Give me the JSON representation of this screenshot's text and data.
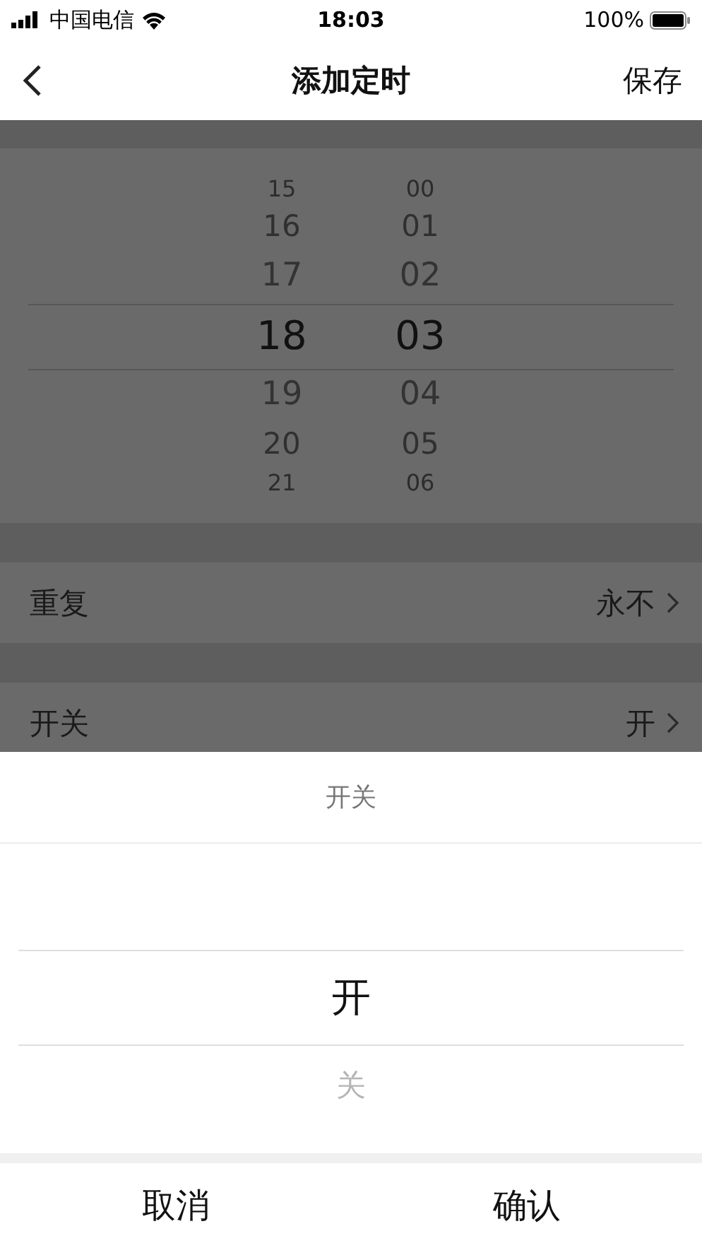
{
  "status_bar": {
    "carrier": "中国电信",
    "time": "18:03",
    "battery": "100%"
  },
  "nav": {
    "title": "添加定时",
    "action": "保存"
  },
  "time_picker": {
    "columns": [
      {
        "items": [
          {
            "label": "15",
            "selected": false
          },
          {
            "label": "16",
            "selected": false
          },
          {
            "label": "17",
            "selected": false
          },
          {
            "label": "18",
            "selected": true
          },
          {
            "label": "19",
            "selected": false
          },
          {
            "label": "20",
            "selected": false
          },
          {
            "label": "21",
            "selected": false
          }
        ]
      },
      {
        "items": [
          {
            "label": "00",
            "selected": false
          },
          {
            "label": "01",
            "selected": false
          },
          {
            "label": "02",
            "selected": false
          },
          {
            "label": "03",
            "selected": true
          },
          {
            "label": "04",
            "selected": false
          },
          {
            "label": "05",
            "selected": false
          },
          {
            "label": "06",
            "selected": false
          }
        ]
      }
    ]
  },
  "settings": [
    {
      "label": "重复",
      "value": "永不"
    },
    {
      "label": "开关",
      "value": "开"
    }
  ],
  "sheet": {
    "title": "开关",
    "options": [
      {
        "label": "开",
        "selected": true
      },
      {
        "label": "关",
        "selected": false
      }
    ],
    "buttons": [
      "取消",
      "确认"
    ]
  }
}
